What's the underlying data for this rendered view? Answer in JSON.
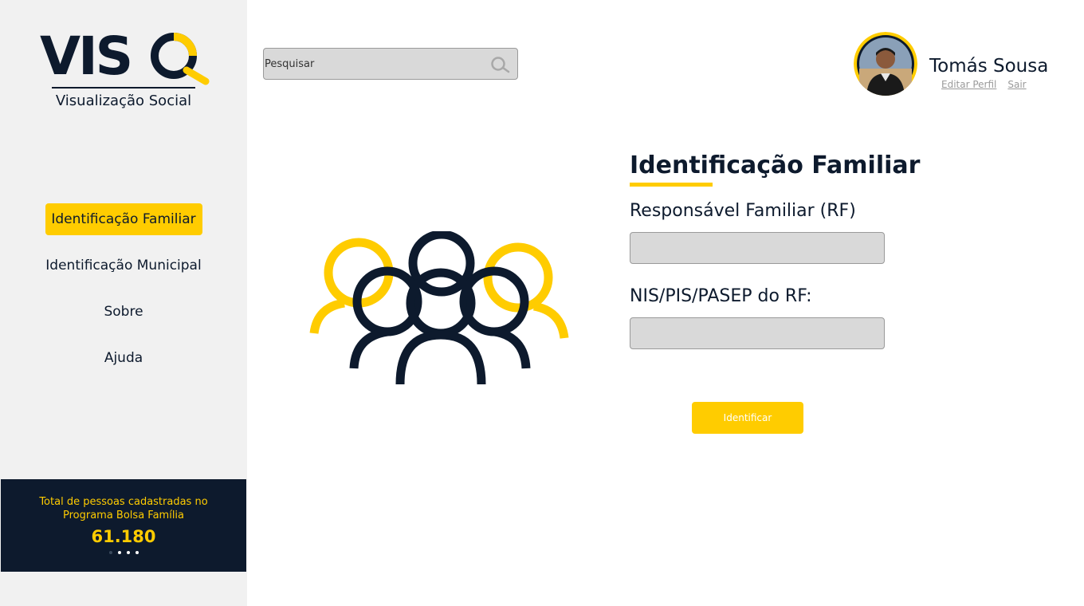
{
  "brand": {
    "logo_text": "VISQ",
    "logo_subtitle": "Visualização Social",
    "accent_color": "#ffcc00",
    "dark_color": "#0d1a2d"
  },
  "sidebar": {
    "items": [
      {
        "label": "Identificação Familiar",
        "active": true
      },
      {
        "label": "Identificação Municipal",
        "active": false
      },
      {
        "label": "Sobre",
        "active": false
      },
      {
        "label": "Ajuda",
        "active": false
      }
    ],
    "stats": {
      "label": "Total de pessoas cadastradas no Programa Bolsa Família",
      "value": "61.180",
      "carousel_pages": 4,
      "carousel_active_index": 0
    }
  },
  "header": {
    "search": {
      "placeholder": "Pesquisar",
      "icon": "search-icon"
    },
    "user": {
      "name": "Tomás Sousa",
      "edit_profile": "Editar Perfil",
      "logout": "Sair",
      "avatar_icon": "avatar"
    }
  },
  "main": {
    "illustration_icon": "people-group-icon",
    "form": {
      "title": "Identificação Familiar",
      "rf_label": "Responsável Familiar (RF)",
      "rf_value": "",
      "nis_label": "NIS/PIS/PASEP do RF:",
      "nis_value": "",
      "submit_label": "Identificar"
    }
  }
}
